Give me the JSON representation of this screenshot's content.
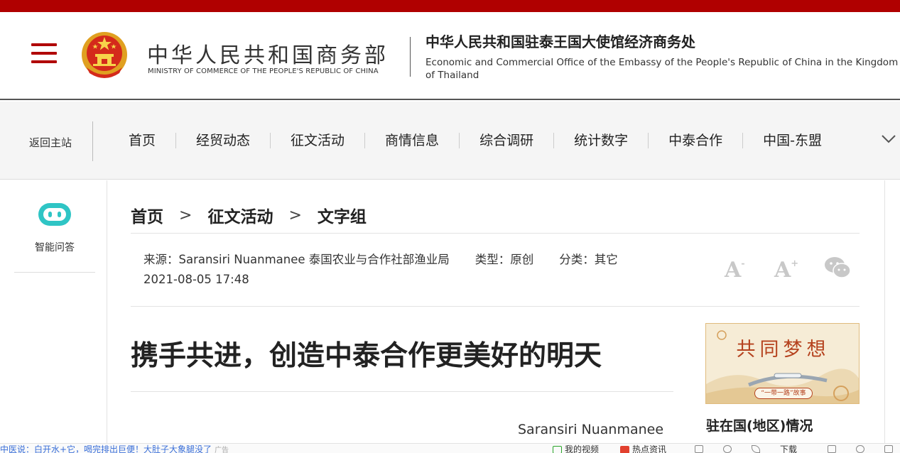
{
  "header": {
    "ministry_cn": "中华人民共和国商务部",
    "ministry_en": "MINISTRY OF COMMERCE OF THE PEOPLE'S REPUBLIC OF CHINA",
    "office_cn": "中华人民共和国驻泰王国大使馆经济商务处",
    "office_en": "Economic and Commercial Office of the Embassy of the People's Republic of China in the Kingdom of Thailand"
  },
  "nav": {
    "back_home": "返回主站",
    "items": [
      "首页",
      "经贸动态",
      "征文活动",
      "商情信息",
      "综合调研",
      "统计数字",
      "中泰合作",
      "中国-东盟"
    ]
  },
  "sidebar": {
    "qa_label": "智能问答"
  },
  "breadcrumb": {
    "items": [
      "首页",
      "征文活动",
      "文字组"
    ],
    "separator": ">"
  },
  "article": {
    "source": "来源：Saransiri Nuanmanee 泰国农业与合作社部渔业局",
    "type": "类型：原创",
    "category": "分类：其它",
    "datetime": "2021-08-05 17:48",
    "title": "携手共进，创造中泰合作更美好的明天",
    "author": "Saransiri Nuanmanee",
    "font_small": "A",
    "font_large": "A",
    "font_small_mark": "-",
    "font_large_mark": "+"
  },
  "side": {
    "banner_title": "共同梦想",
    "banner_sub": "“一带一路”故事",
    "heading": "驻在国(地区)情况"
  },
  "bottombar": {
    "ticker": "中医说：白开水+它，喝完排出巨便！大肚子大象腿没了",
    "ticker_tag": "广告",
    "video": "我的视频",
    "hot": "热点资讯",
    "download": "下载"
  },
  "colors": {
    "brand_red": "#b00000",
    "robot_teal": "#2fc5c5",
    "banner_red": "#b5421e"
  },
  "icons": [
    "menu-icon",
    "national-emblem-icon",
    "chevron-down-icon",
    "robot-icon",
    "wechat-icon"
  ]
}
